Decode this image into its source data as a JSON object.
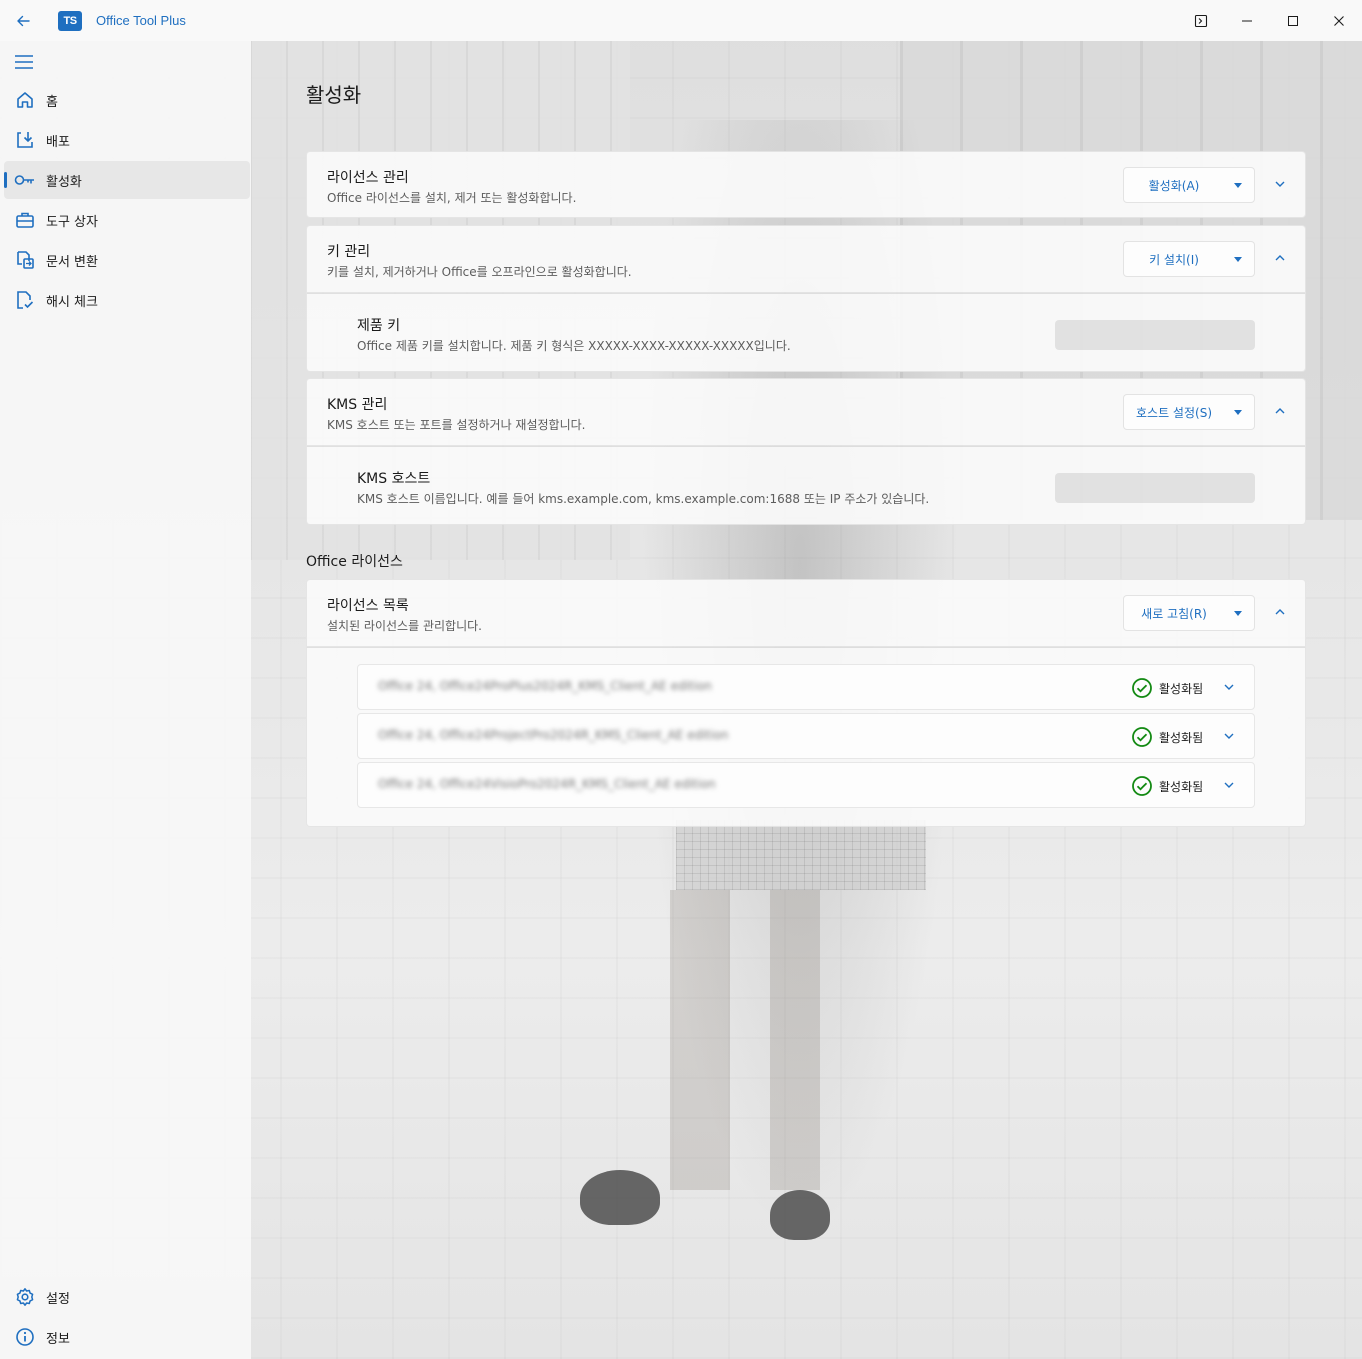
{
  "window": {
    "title": "Office Tool Plus",
    "logo_text": "TS",
    "controls": [
      "terminal-icon",
      "minimize-icon",
      "maximize-icon",
      "close-icon"
    ]
  },
  "sidebar": {
    "items": [
      {
        "label": "홈",
        "icon": "home-icon",
        "active": false
      },
      {
        "label": "배포",
        "icon": "deploy-icon",
        "active": false
      },
      {
        "label": "활성화",
        "icon": "key-icon",
        "active": true
      },
      {
        "label": "도구 상자",
        "icon": "toolbox-icon",
        "active": false
      },
      {
        "label": "문서 변환",
        "icon": "document-convert-icon",
        "active": false
      },
      {
        "label": "해시 체크",
        "icon": "hash-check-icon",
        "active": false
      }
    ],
    "footer": [
      {
        "label": "설정",
        "icon": "settings-icon"
      },
      {
        "label": "정보",
        "icon": "info-icon"
      }
    ]
  },
  "main": {
    "title": "활성화",
    "license_management": {
      "title": "라이선스 관리",
      "description": "Office 라이선스를 설치, 제거 또는 활성화합니다.",
      "button": "활성화(A)"
    },
    "key_management": {
      "title": "키 관리",
      "description": "키를 설치, 제거하거나 Office를 오프라인으로 활성화합니다.",
      "button": "키 설치(I)",
      "product_key": {
        "title": "제품 키",
        "description": "Office 제품 키를 설치합니다. 제품 키 형식은 XXXXX-XXXX-XXXXX-XXXXX입니다.",
        "value": ""
      }
    },
    "kms_management": {
      "title": "KMS 관리",
      "description": "KMS 호스트 또는 포트를 설정하거나 재설정합니다.",
      "button": "호스트 설정(S)",
      "kms_host": {
        "title": "KMS 호스트",
        "description": "KMS 호스트 이름입니다. 예를 들어 kms.example.com, kms.example.com:1688 또는 IP 주소가 있습니다.",
        "value": ""
      }
    },
    "office_licenses": {
      "section_title": "Office 라이선스",
      "list_title": "라이선스 목록",
      "list_description": "설치된 라이선스를 관리합니다.",
      "button": "새로 고침(R)",
      "licenses": [
        {
          "name": "Office 24, Office24ProPlus2024R_KMS_Client_AE edition",
          "status": "활성화됨"
        },
        {
          "name": "Office 24, Office24ProjectPro2024R_KMS_Client_AE edition",
          "status": "활성화됨"
        },
        {
          "name": "Office 24, Office24VisioPro2024R_KMS_Client_AE edition",
          "status": "활성화됨"
        }
      ]
    }
  },
  "colors": {
    "accent": "#1f6fc0",
    "success": "#138a13"
  }
}
